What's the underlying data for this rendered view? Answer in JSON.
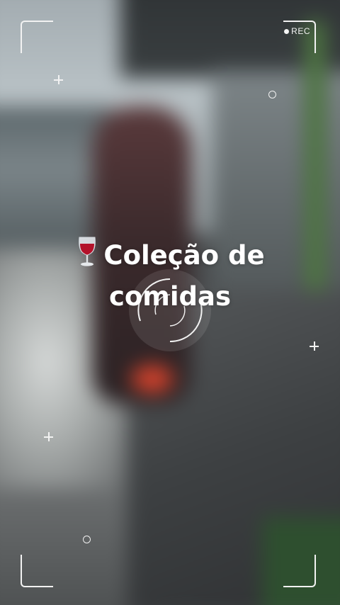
{
  "overlay": {
    "rec_label": "REC"
  },
  "title": {
    "line1": "Coleção de",
    "line2": "comidas",
    "icon": "wine-glass-icon"
  },
  "colors": {
    "overlay": "#f2f2f2",
    "wine": "#b3122a"
  }
}
